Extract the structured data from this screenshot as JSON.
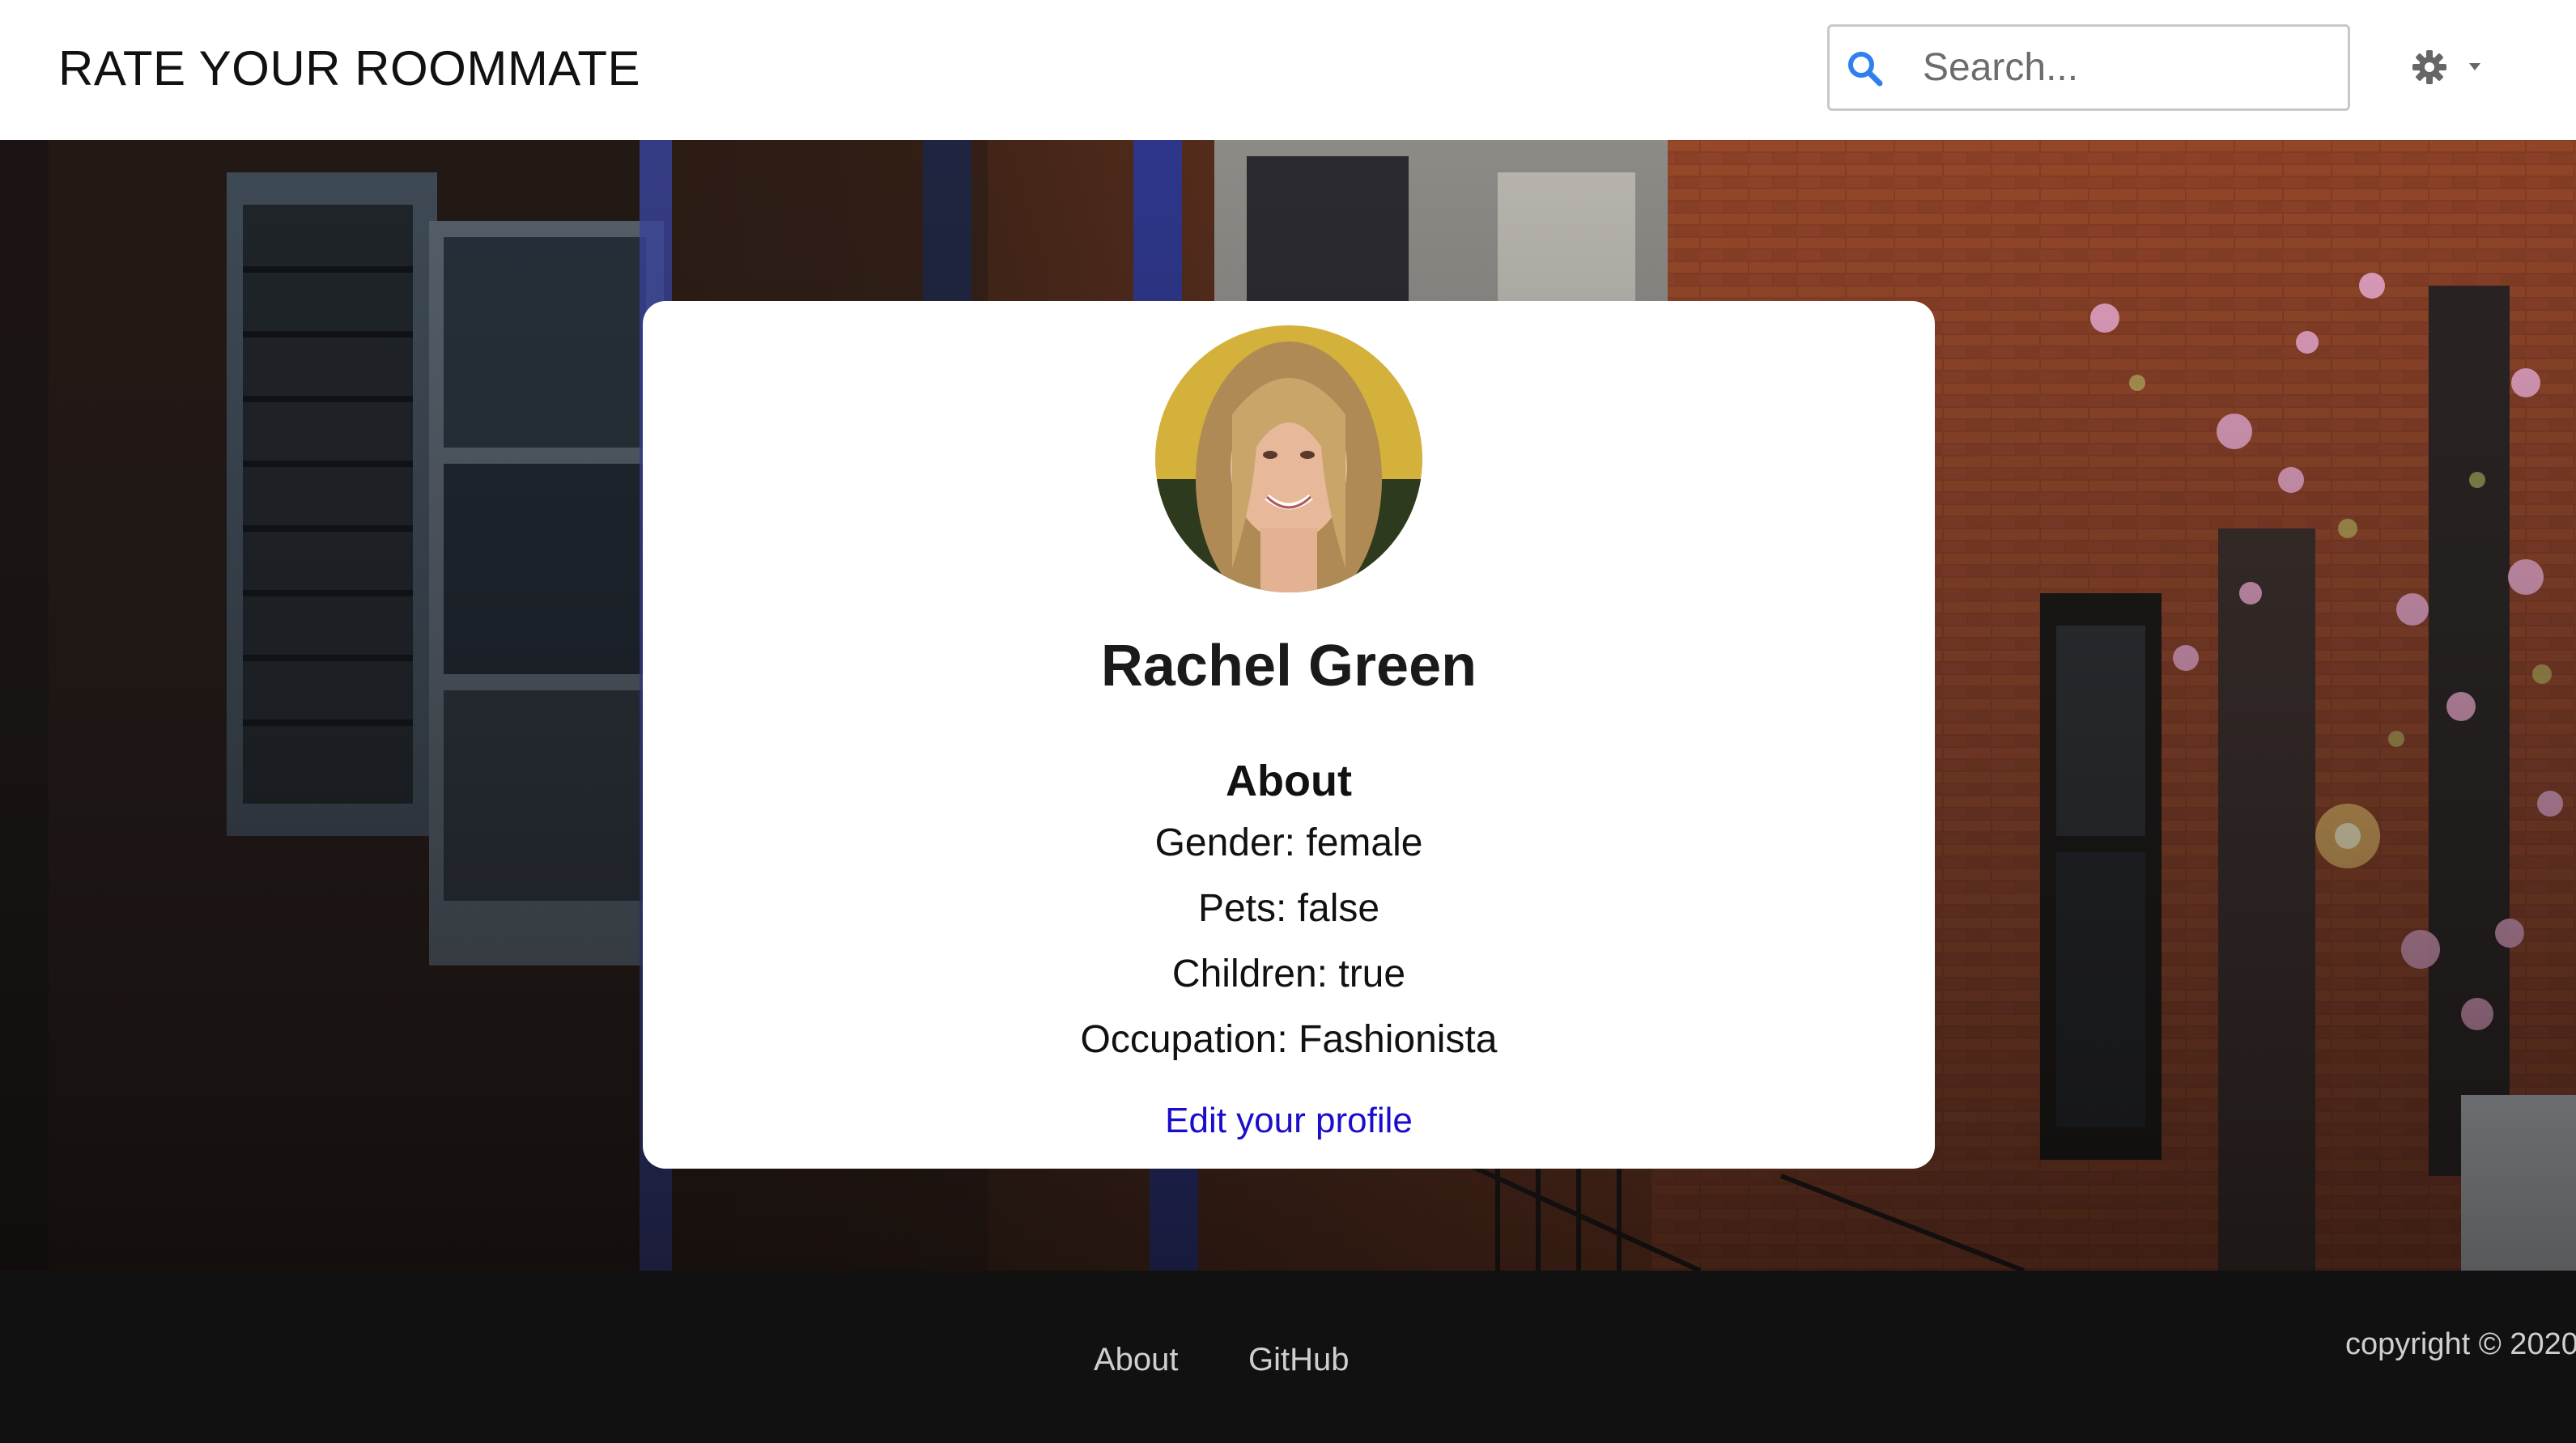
{
  "header": {
    "brand": "RATE YOUR ROOMMATE",
    "search": {
      "placeholder": "Search..."
    },
    "icons": {
      "search": "search-icon",
      "settings": "gear-icon",
      "dropdown": "caret-down-icon"
    }
  },
  "profile": {
    "name": "Rachel Green",
    "about_heading": "About",
    "attributes": [
      {
        "label": "Gender: female"
      },
      {
        "label": "Pets: false"
      },
      {
        "label": "Children: true"
      },
      {
        "label": "Occupation: Fashionista"
      }
    ],
    "edit_link": "Edit your profile"
  },
  "footer": {
    "links": [
      {
        "label": "About"
      },
      {
        "label": "GitHub"
      }
    ],
    "copyright": "copyright © 2020"
  },
  "colors": {
    "navbar_bg": "#ffffff",
    "footer_bg": "#111111",
    "link": "#1a0dcc",
    "search_icon": "#2f80ed"
  }
}
